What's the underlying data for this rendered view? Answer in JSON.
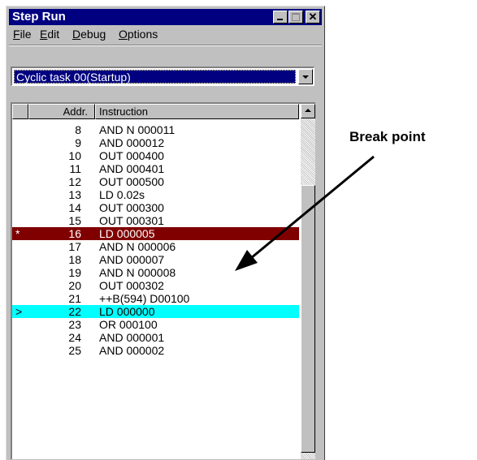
{
  "window": {
    "title": "Step Run",
    "buttons": {
      "minimize": "_",
      "maximize": "□",
      "close": "✕"
    }
  },
  "menu": [
    {
      "label": "File",
      "accel": "F"
    },
    {
      "label": "Edit",
      "accel": "E"
    },
    {
      "label": "Debug",
      "accel": "D"
    },
    {
      "label": "Options",
      "accel": "O"
    }
  ],
  "task_selector": {
    "value": "Cyclic task 00(Startup)"
  },
  "table": {
    "columns": [
      "",
      "Addr.",
      "Instruction"
    ],
    "rows": [
      {
        "mark": "",
        "addr": "8",
        "instr": "AND N 000011",
        "state": "normal"
      },
      {
        "mark": "",
        "addr": "9",
        "instr": "AND 000012",
        "state": "normal"
      },
      {
        "mark": "",
        "addr": "10",
        "instr": "OUT 000400",
        "state": "normal"
      },
      {
        "mark": "",
        "addr": "11",
        "instr": "AND 000401",
        "state": "normal"
      },
      {
        "mark": "",
        "addr": "12",
        "instr": "OUT 000500",
        "state": "normal"
      },
      {
        "mark": "",
        "addr": "13",
        "instr": "LD 0.02s",
        "state": "normal"
      },
      {
        "mark": "",
        "addr": "14",
        "instr": "OUT 000300",
        "state": "normal"
      },
      {
        "mark": "",
        "addr": "15",
        "instr": "OUT 000301",
        "state": "normal"
      },
      {
        "mark": "*",
        "addr": "16",
        "instr": "LD 000005",
        "state": "breakpoint"
      },
      {
        "mark": "",
        "addr": "17",
        "instr": "AND N 000006",
        "state": "normal"
      },
      {
        "mark": "",
        "addr": "18",
        "instr": "AND 000007",
        "state": "normal"
      },
      {
        "mark": "",
        "addr": "19",
        "instr": "AND N 000008",
        "state": "normal"
      },
      {
        "mark": "",
        "addr": "20",
        "instr": "OUT 000302",
        "state": "normal"
      },
      {
        "mark": "",
        "addr": "21",
        "instr": "++B(594) D00100",
        "state": "normal"
      },
      {
        "mark": ">",
        "addr": "22",
        "instr": "LD 000000",
        "state": "current"
      },
      {
        "mark": "",
        "addr": "23",
        "instr": "OR 000100",
        "state": "normal"
      },
      {
        "mark": "",
        "addr": "24",
        "instr": "AND 000001",
        "state": "normal"
      },
      {
        "mark": "",
        "addr": "25",
        "instr": "AND 000002",
        "state": "normal"
      }
    ]
  },
  "annotation": {
    "label": "Break point"
  },
  "colors": {
    "titlebar": "#000080",
    "breakpoint_row": "#800000",
    "current_row": "#00ffff"
  }
}
